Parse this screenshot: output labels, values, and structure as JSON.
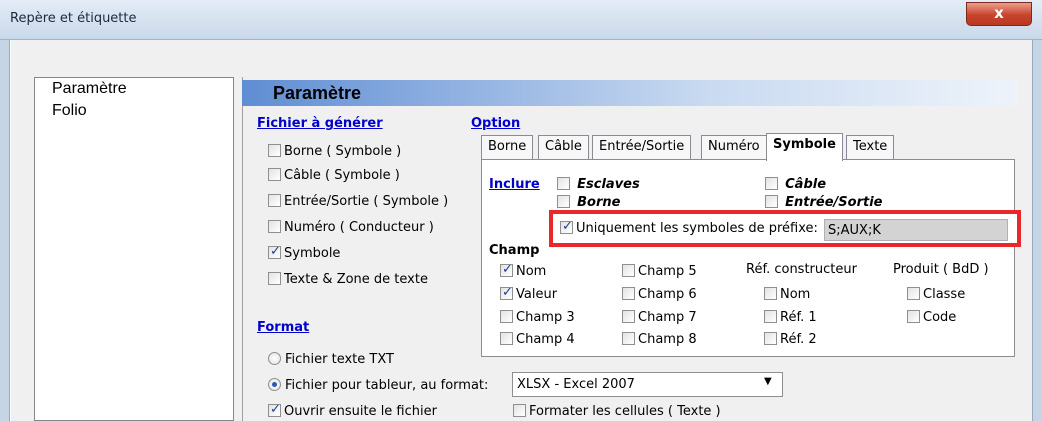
{
  "window": {
    "title": "Repère et étiquette",
    "close_glyph": "x"
  },
  "nav": {
    "items": [
      {
        "label": "Paramètre"
      },
      {
        "label": "Folio"
      }
    ]
  },
  "panel": {
    "title": "Paramètre"
  },
  "fichier": {
    "heading": "Fichier à générer",
    "items": [
      {
        "label": "Borne ( Symbole )",
        "checked": false
      },
      {
        "label": "Câble ( Symbole )",
        "checked": false
      },
      {
        "label": "Entrée/Sortie ( Symbole )",
        "checked": false
      },
      {
        "label": "Numéro ( Conducteur )",
        "checked": false
      },
      {
        "label": "Symbole",
        "checked": true
      },
      {
        "label": "Texte & Zone de texte",
        "checked": false
      }
    ]
  },
  "format": {
    "heading": "Format",
    "radios": [
      {
        "label": "Fichier texte TXT",
        "selected": false
      },
      {
        "label": "Fichier pour tableur, au format:",
        "selected": true
      }
    ],
    "combo_value": "XLSX - Excel 2007",
    "open_after": {
      "label": "Ouvrir ensuite le fichier",
      "checked": true
    },
    "format_cells": {
      "label": "Formater les cellules ( Texte )",
      "checked": false
    }
  },
  "option": {
    "heading": "Option",
    "tabs": [
      "Borne",
      "Câble",
      "Entrée/Sortie",
      "Numéro",
      "Symbole",
      "Texte"
    ],
    "active_tab": "Symbole"
  },
  "inclure": {
    "label": "Inclure",
    "items": [
      {
        "label": "Esclaves",
        "checked": false
      },
      {
        "label": "Câble",
        "checked": false
      },
      {
        "label": "Borne",
        "checked": false
      },
      {
        "label": "Entrée/Sortie",
        "checked": false
      }
    ],
    "prefix_only": {
      "label": "Uniquement les symboles de préfixe:",
      "checked": true,
      "value": "S;AUX;K"
    }
  },
  "champ": {
    "label": "Champ",
    "col1": [
      {
        "label": "Nom",
        "checked": true
      },
      {
        "label": "Valeur",
        "checked": true
      },
      {
        "label": "Champ 3",
        "checked": false
      },
      {
        "label": "Champ 4",
        "checked": false
      }
    ],
    "col2": [
      {
        "label": "Champ 5",
        "checked": false
      },
      {
        "label": "Champ 6",
        "checked": false
      },
      {
        "label": "Champ 7",
        "checked": false
      },
      {
        "label": "Champ 8",
        "checked": false
      }
    ],
    "ref_constructeur": {
      "label": "Réf. constructeur",
      "items": [
        {
          "label": "Nom",
          "checked": false
        },
        {
          "label": "Réf. 1",
          "checked": false
        },
        {
          "label": "Réf. 2",
          "checked": false
        }
      ]
    },
    "produit": {
      "label": "Produit ( BdD )",
      "items": [
        {
          "label": "Classe",
          "checked": false
        },
        {
          "label": "Code",
          "checked": false
        }
      ]
    }
  }
}
